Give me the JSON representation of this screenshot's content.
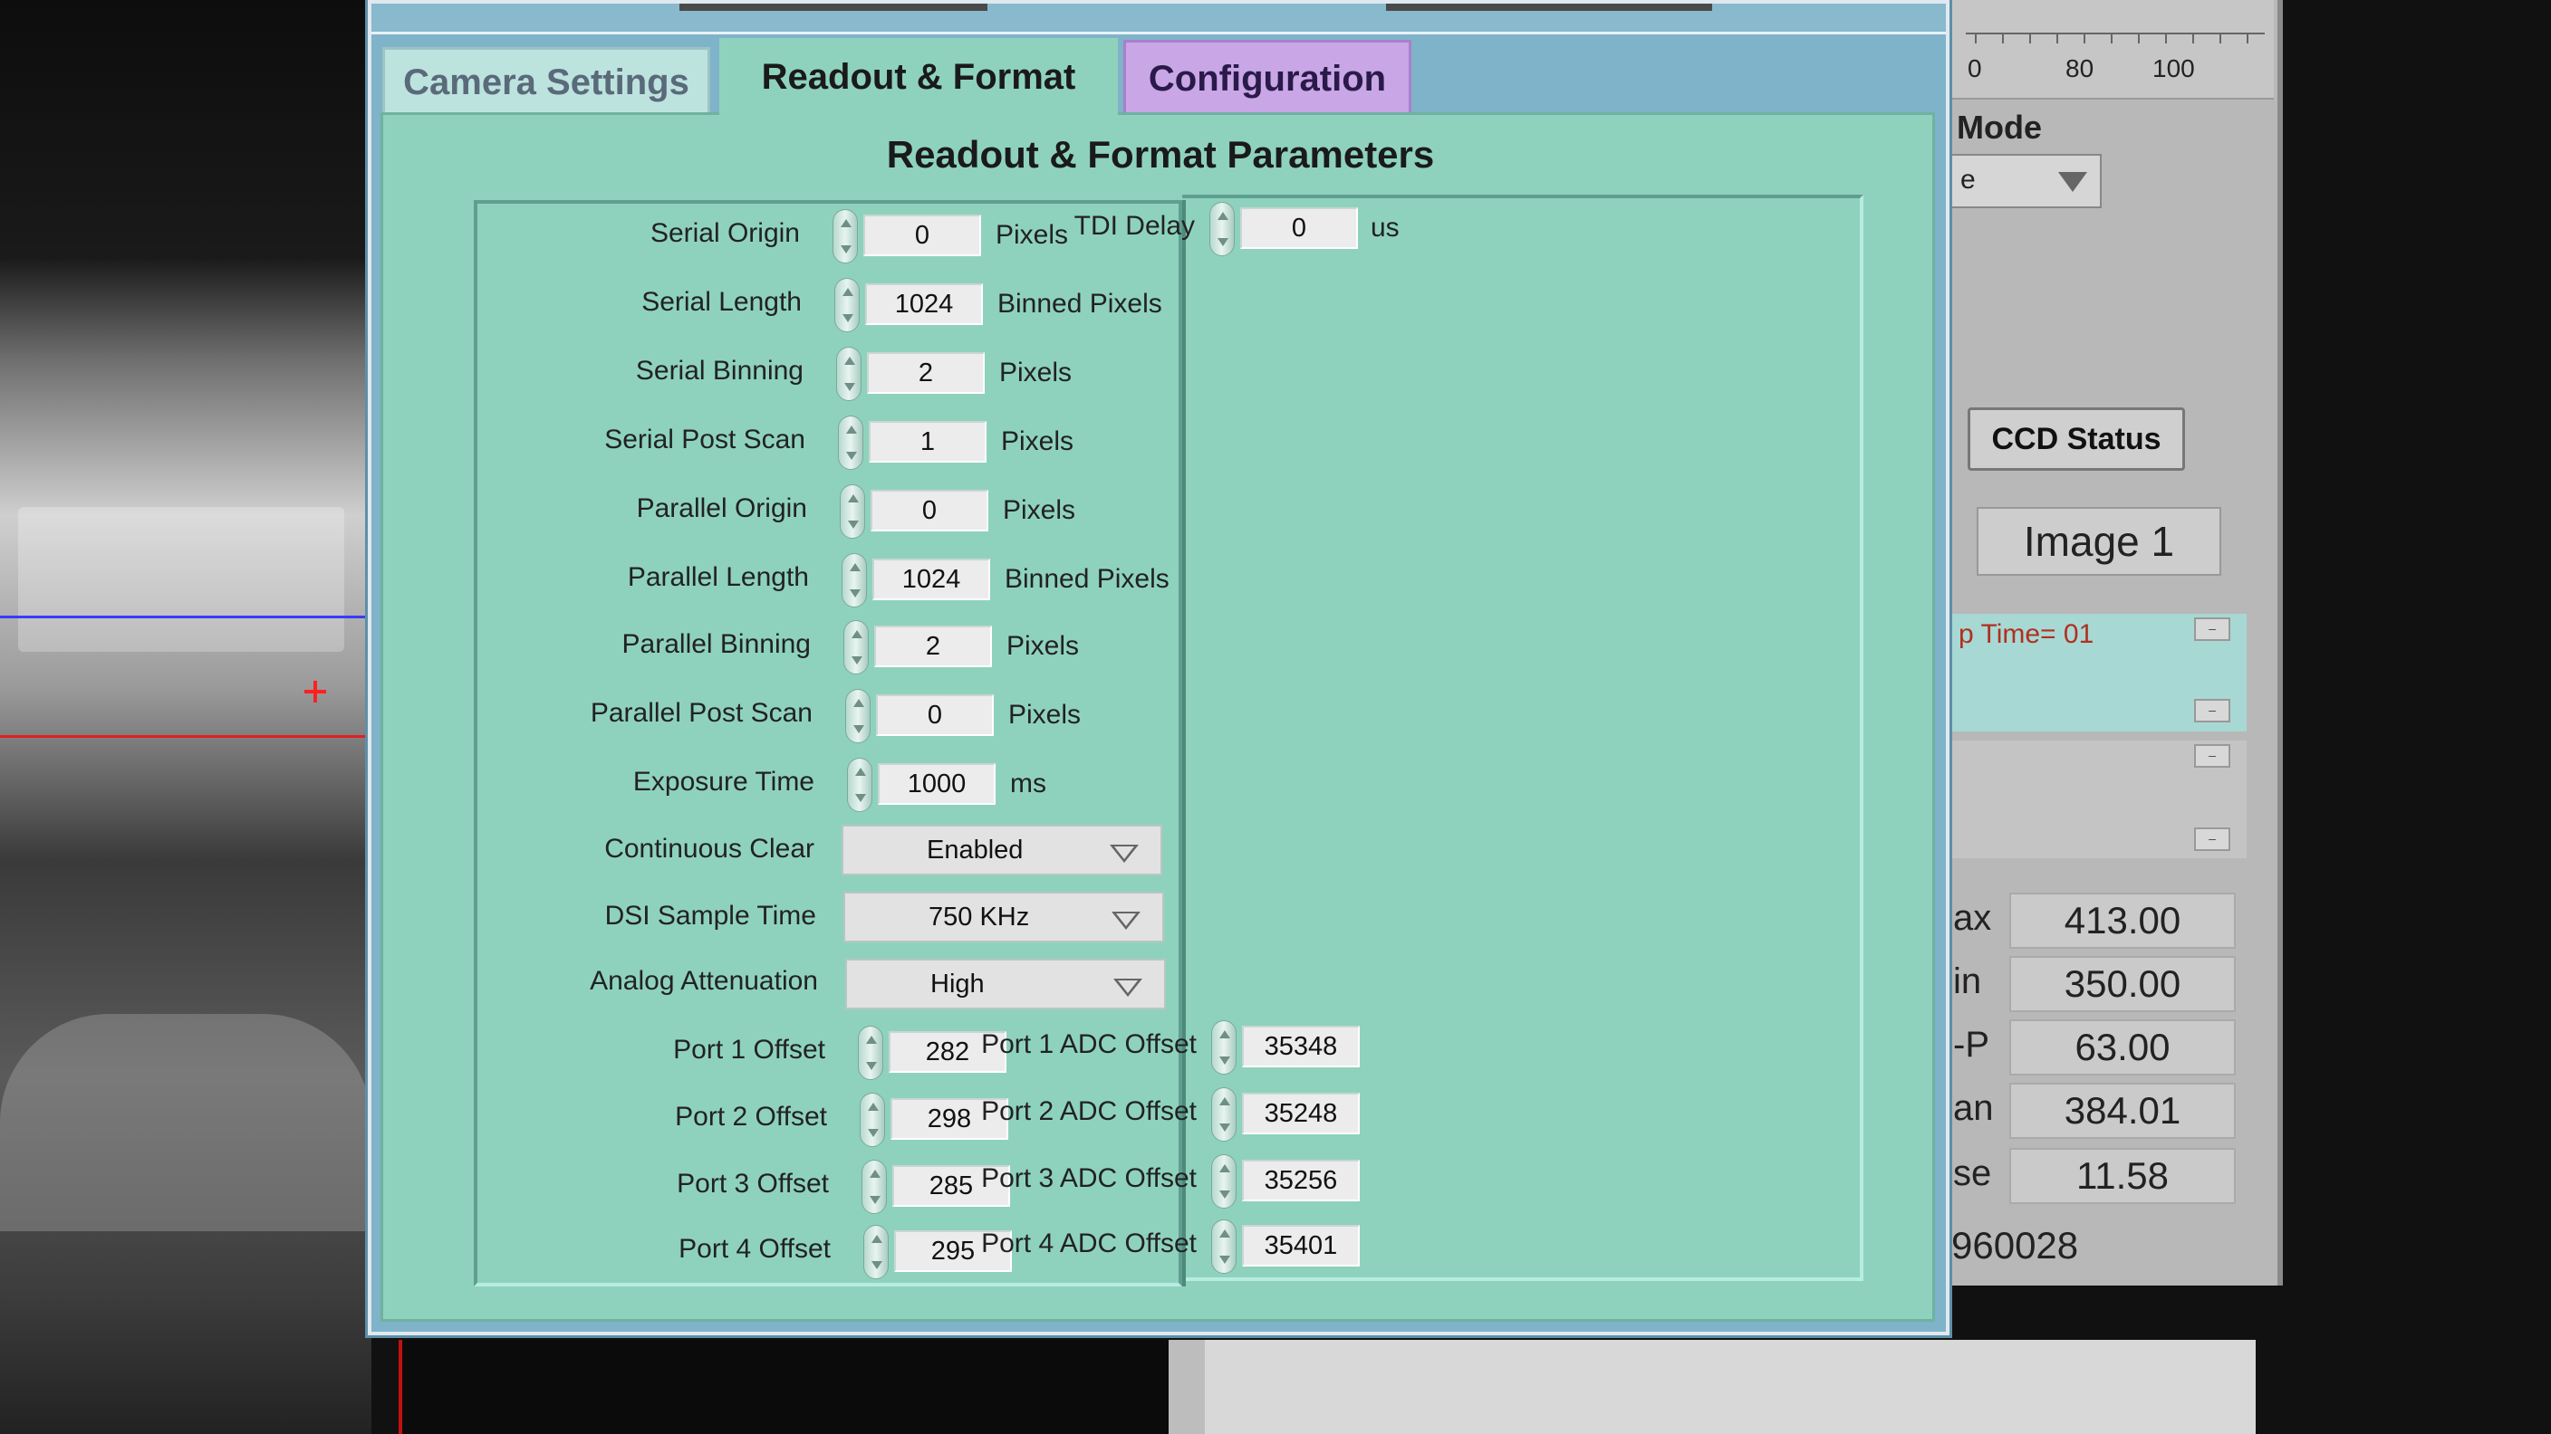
{
  "tabs": [
    {
      "label": "Camera Settings"
    },
    {
      "label": "Readout & Format"
    },
    {
      "label": "Configuration"
    }
  ],
  "section_title": "Readout & Format  Parameters",
  "left_params": [
    {
      "label": "Serial Origin",
      "value": "0",
      "unit": "Pixels"
    },
    {
      "label": "Serial Length",
      "value": "1024",
      "unit": "Binned Pixels"
    },
    {
      "label": "Serial Binning",
      "value": "2",
      "unit": "Pixels"
    },
    {
      "label": "Serial Post Scan",
      "value": "1",
      "unit": "Pixels"
    },
    {
      "label": "Parallel Origin",
      "value": "0",
      "unit": "Pixels"
    },
    {
      "label": "Parallel Length",
      "value": "1024",
      "unit": "Binned Pixels"
    },
    {
      "label": "Parallel Binning",
      "value": "2",
      "unit": "Pixels"
    },
    {
      "label": "Parallel Post Scan",
      "value": "0",
      "unit": "Pixels"
    },
    {
      "label": "Exposure Time",
      "value": "1000",
      "unit": "ms"
    }
  ],
  "dropdowns": [
    {
      "label": "Continuous Clear",
      "value": "Enabled"
    },
    {
      "label": "DSI Sample Time",
      "value": "750 KHz"
    },
    {
      "label": "Analog Attenuation",
      "value": "High"
    }
  ],
  "port_offsets": [
    {
      "label": "Port 1 Offset",
      "value": "282"
    },
    {
      "label": "Port 2 Offset",
      "value": "298"
    },
    {
      "label": "Port 3 Offset",
      "value": "285"
    },
    {
      "label": "Port 4 Offset",
      "value": "295"
    }
  ],
  "tdi_delay": {
    "label": "TDI Delay",
    "value": "0",
    "unit": "us"
  },
  "adc_offsets": [
    {
      "label": "Port 1 ADC Offset",
      "value": "35348"
    },
    {
      "label": "Port 2 ADC Offset",
      "value": "35248"
    },
    {
      "label": "Port 3 ADC Offset",
      "value": "35256"
    },
    {
      "label": "Port 4 ADC Offset",
      "value": "35401"
    }
  ],
  "right_panel": {
    "scale_labels": [
      "0",
      "80",
      "100"
    ],
    "mode_label": "Mode",
    "mode_value": "e",
    "ccd_status_button": "CCD Status",
    "image_name": "Image 1",
    "log_text": "p Time= 01",
    "stats": [
      {
        "label": "ax",
        "value": "413.00"
      },
      {
        "label": "in",
        "value": "350.00"
      },
      {
        "label": "-P",
        "value": "63.00"
      },
      {
        "label": "an",
        "value": "384.01"
      },
      {
        "label": "se",
        "value": "11.58"
      }
    ],
    "serial": "960028"
  },
  "colors": {
    "tab_active": "#8ed2bd",
    "tab_config": "#c9a6e6",
    "tab_inactive": "#bde3df",
    "window_border": "#7fb3c9"
  }
}
